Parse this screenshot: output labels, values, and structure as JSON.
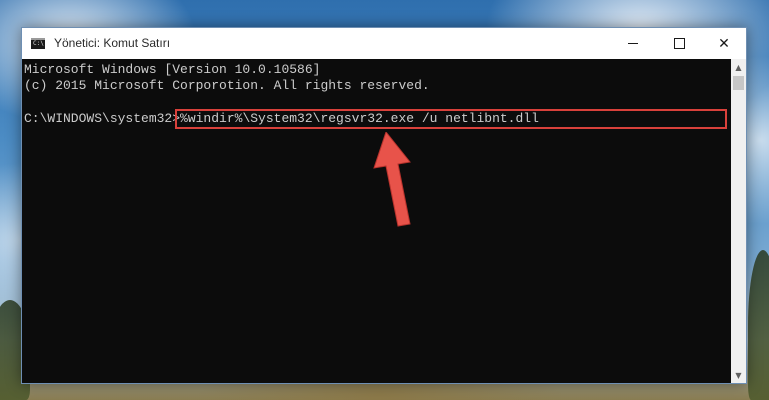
{
  "window": {
    "title": "Yönetici: Komut Satırı",
    "icon_text": "C:\\"
  },
  "titlebar_buttons": {
    "minimize": "minimize-icon",
    "maximize": "maximize-icon",
    "close": "✕"
  },
  "console": {
    "line1": "Microsoft Windows [Version 10.0.10586]",
    "line2": "(c) 2015 Microsoft Corporotion. All rights reserved.",
    "prompt": "C:\\WINDOWS\\system32>",
    "command": "%windir%\\System32\\regsvr32.exe /u netlibnt.dll"
  },
  "scrollbar": {
    "up_arrow": "▲",
    "down_arrow": "▼"
  },
  "colors": {
    "highlight": "#d9413b",
    "pointer_arrow": "#e8534a",
    "console_background": "#0c0c0c",
    "console_text": "#cccccc"
  },
  "icons": {
    "pointer": "red-arrow-icon"
  }
}
